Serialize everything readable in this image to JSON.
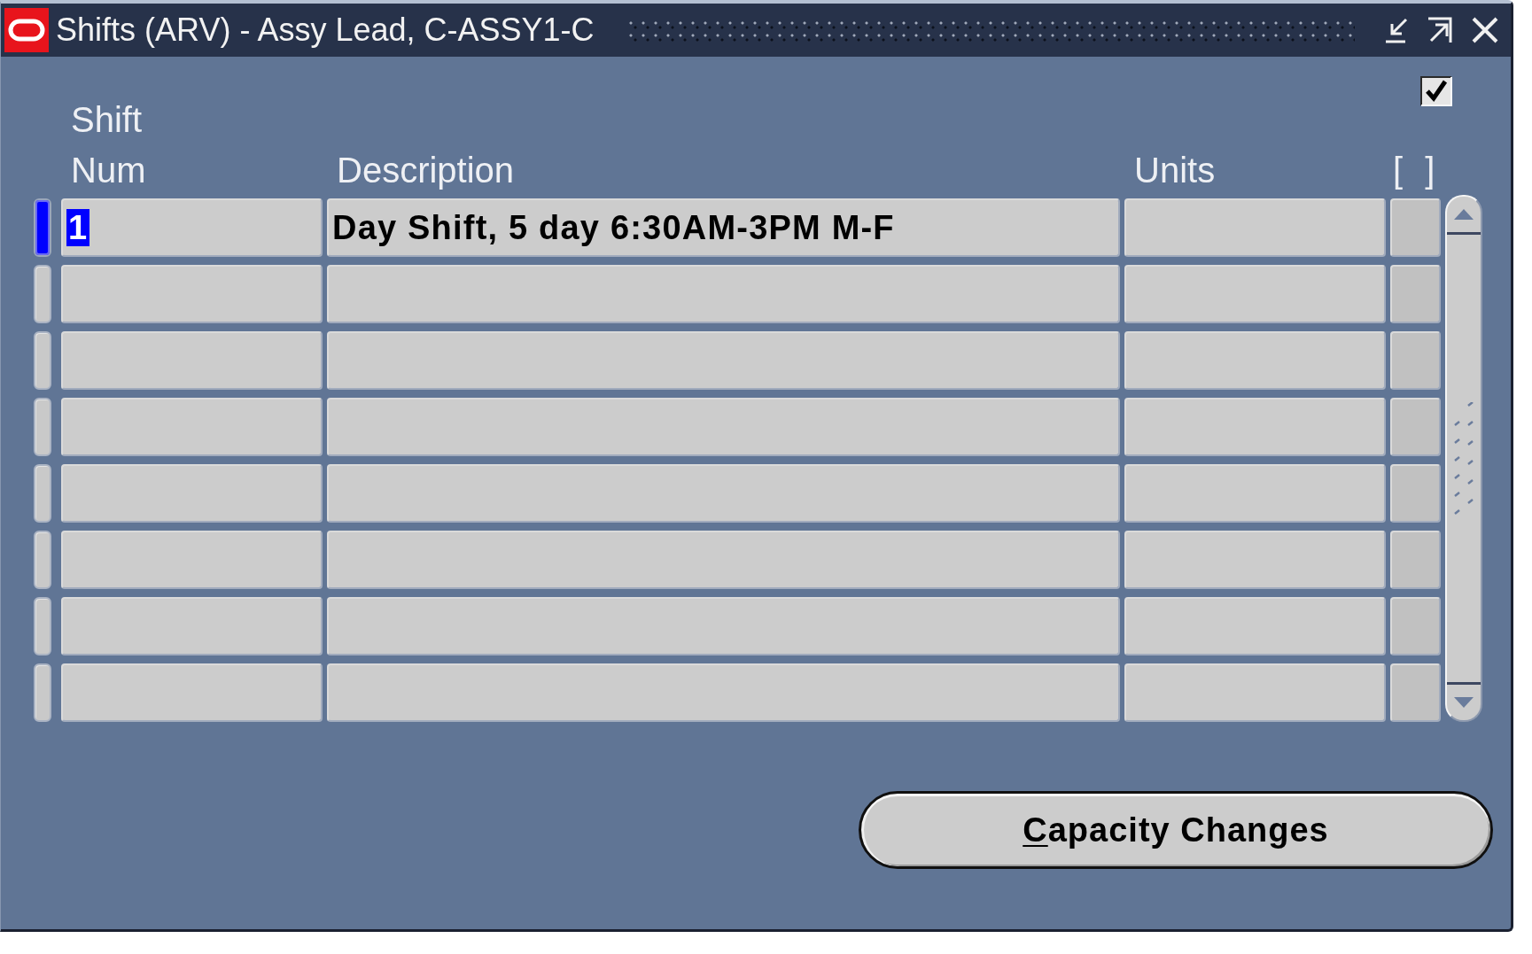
{
  "window": {
    "title": "Shifts (ARV) - Assy Lead, C-ASSY1-C"
  },
  "folder_checkbox": {
    "checked": true
  },
  "table": {
    "columns": [
      {
        "label": "Shift\nNum"
      },
      {
        "label": "Description"
      },
      {
        "label": "Units"
      },
      {
        "label": "[ ]"
      }
    ],
    "rows": [
      {
        "selected": true,
        "num": "1",
        "description": "Day Shift, 5 day 6:30AM-3PM M-F"
      },
      {
        "selected": false
      },
      {
        "selected": false
      },
      {
        "selected": false
      },
      {
        "selected": false
      },
      {
        "selected": false
      },
      {
        "selected": false
      },
      {
        "selected": false
      }
    ]
  },
  "buttons": [
    {
      "label_parts": [
        {
          "text": "C",
          "underlined": true
        },
        {
          "text": "apacity Changes",
          "underlined": false
        }
      ]
    }
  ]
}
